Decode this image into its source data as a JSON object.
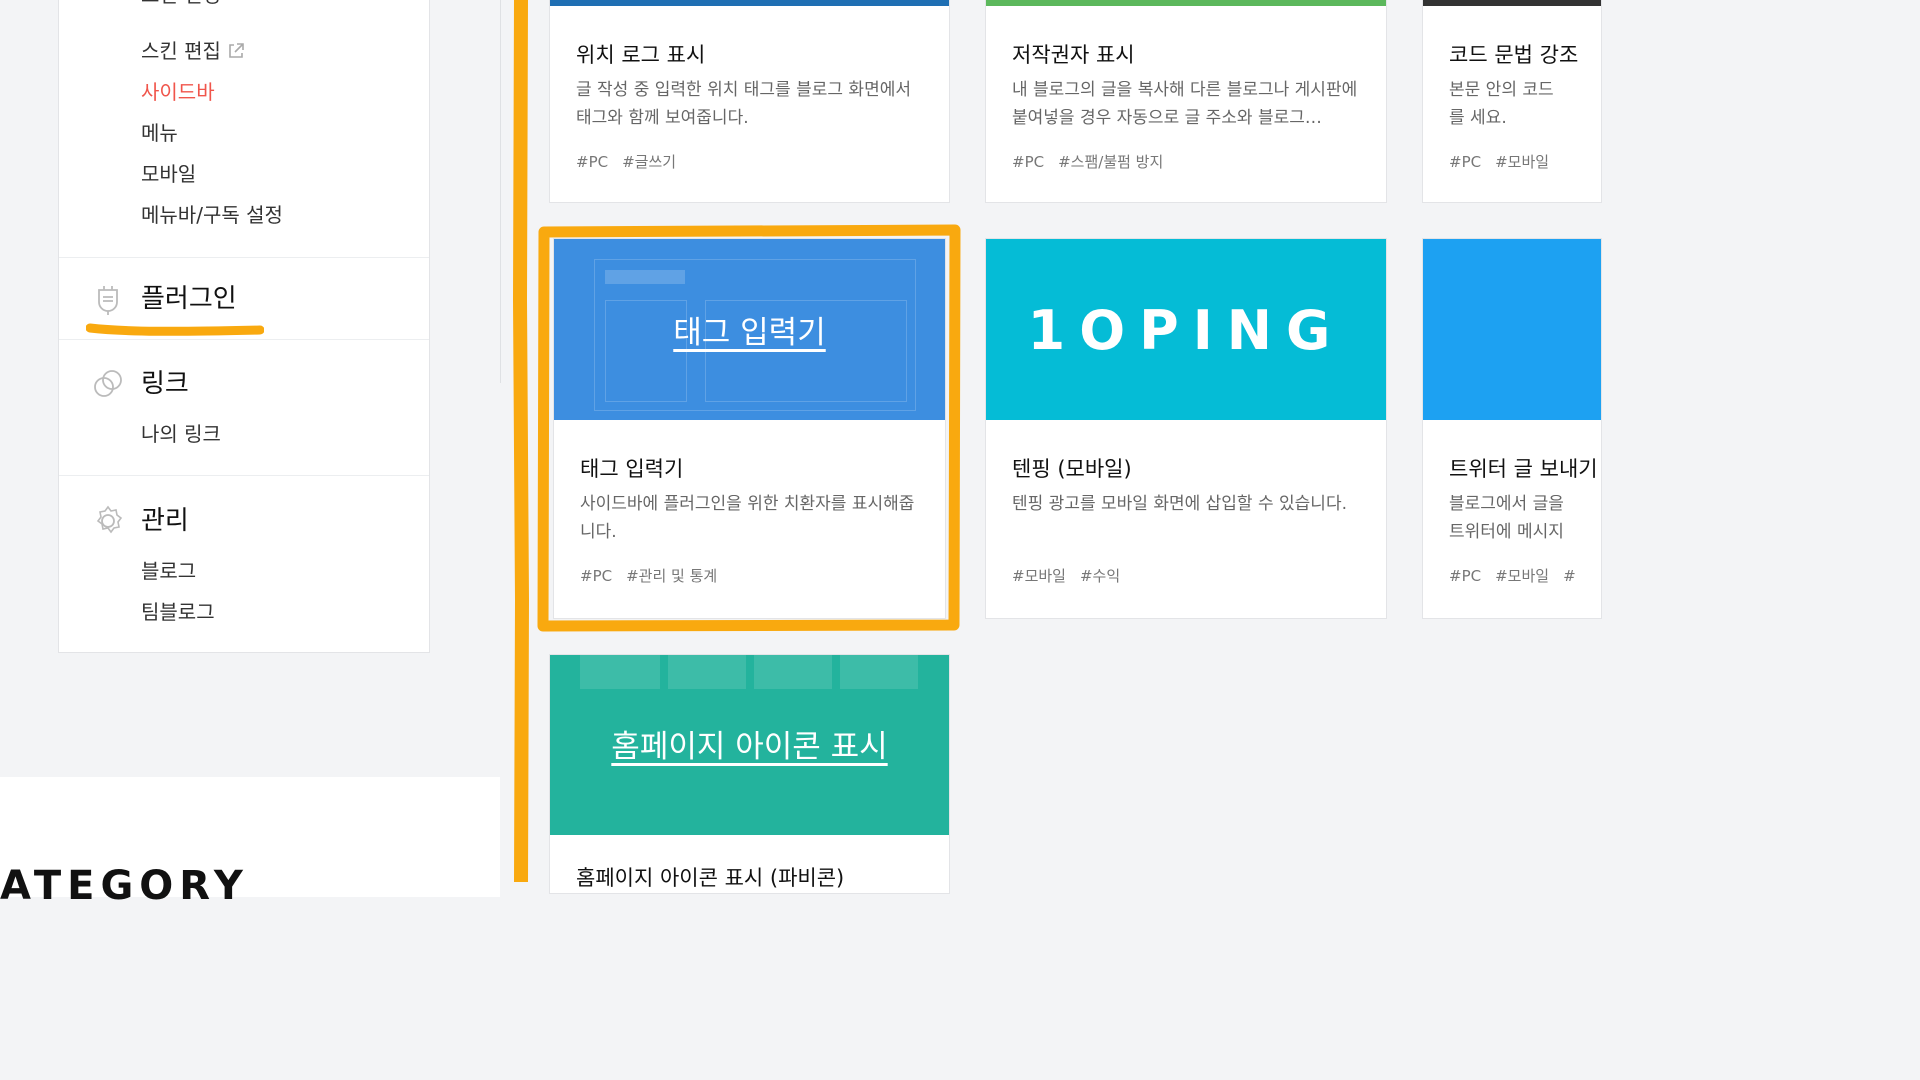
{
  "sidebar": {
    "skin_items": [
      "스킨 변경",
      "스킨 편집",
      "사이드바",
      "메뉴",
      "모바일",
      "메뉴바/구독 설정"
    ],
    "sections": {
      "plugin": {
        "title": "플러그인",
        "icon": "plug-icon"
      },
      "link": {
        "title": "링크",
        "icon": "link-icon",
        "items": [
          "나의 링크"
        ]
      },
      "manage": {
        "title": "관리",
        "icon": "gear-icon",
        "items": [
          "블로그",
          "팀블로그"
        ]
      }
    }
  },
  "bottom_partial_text": "ATEGORY",
  "cards": [
    {
      "title": "위치 로그 표시",
      "desc": "글 작성 중 입력한 위치 태그를 블로그 화면에서 태그와 함께 보여줍니다.",
      "tags": [
        "#PC",
        "#글쓰기"
      ],
      "bar_color": "#1f6fb3"
    },
    {
      "title": "저작권자 표시",
      "desc": "내 블로그의 글을 복사해 다른 블로그나 게시판에 붙여넣을 경우 자동으로 글 주소와 블로그…",
      "tags": [
        "#PC",
        "#스팸/불펌 방지"
      ],
      "bar_color": "#5cb85c"
    },
    {
      "title": "코드 문법 강조",
      "desc": "본문 안의 코드를 세요.",
      "tags": [
        "#PC",
        "#모바일"
      ],
      "bar_color": "#333333"
    },
    {
      "title": "태그 입력기",
      "banner_text": "태그 입력기",
      "desc": "사이드바에 플러그인을 위한 치환자를 표시해줍니다.",
      "tags": [
        "#PC",
        "#관리 및 통계"
      ],
      "banner_color": "#3d8ee0"
    },
    {
      "title": "텐핑 (모바일)",
      "banner_text": "1OPING",
      "desc": "텐핑 광고를 모바일 화면에 삽입할 수 있습니다.",
      "tags": [
        "#모바일",
        "#수익"
      ],
      "banner_color": "#05bcd6"
    },
    {
      "title": "트위터 글 보내기",
      "desc": "블로그에서 글을 트위터에 메시지",
      "tags": [
        "#PC",
        "#모바일",
        "#"
      ],
      "banner_color": "#1da1f2"
    },
    {
      "title": "홈페이지 아이콘 표시 (파비콘)",
      "banner_text": "홈페이지 아이콘 표시",
      "banner_color": "#23b39d"
    }
  ],
  "colors": {
    "accent_red": "#f0554b",
    "highlight_orange": "#f9a90f"
  }
}
